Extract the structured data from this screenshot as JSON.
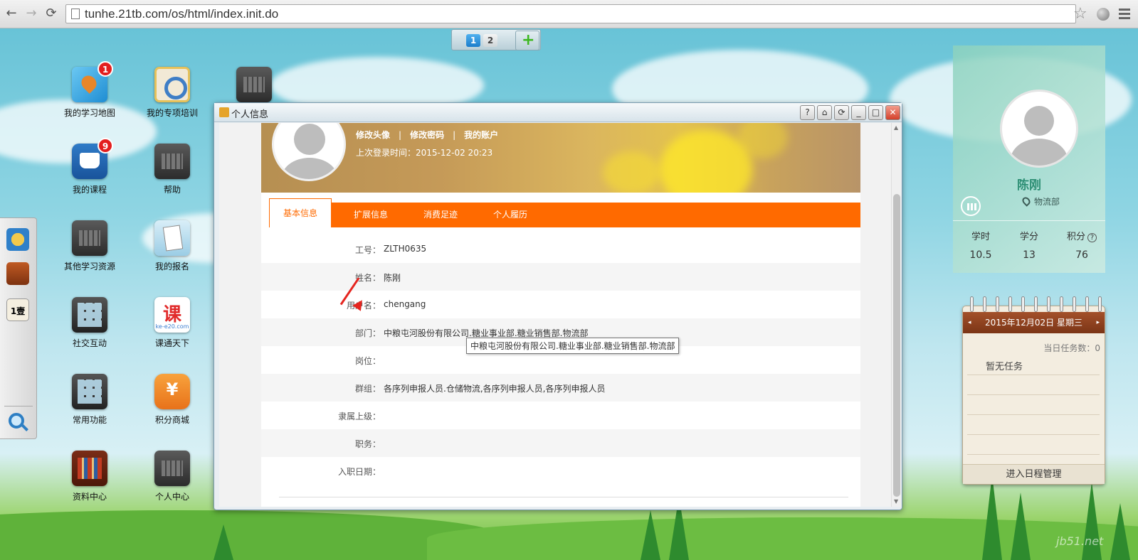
{
  "browser": {
    "url": "tunhe.21tb.com/os/html/index.init.do"
  },
  "switcher": {
    "desktops": [
      "1",
      "2"
    ],
    "add_label": "+"
  },
  "desktop_icons": [
    {
      "label": "我的学习地图",
      "badge": "1",
      "icon": "map-icon"
    },
    {
      "label": "我的专项培训",
      "icon": "training-icon"
    },
    {
      "label": "",
      "icon": "app-icon"
    },
    {
      "label": "我的课程",
      "badge": "9",
      "icon": "course-icon"
    },
    {
      "label": "帮助",
      "icon": "help-icon"
    },
    {
      "label": "其他学习资源",
      "icon": "resources-icon"
    },
    {
      "label": "我的报名",
      "icon": "signup-icon"
    },
    {
      "label": "社交互动",
      "icon": "social-icon"
    },
    {
      "label": "课通天下",
      "icon": "ke-icon",
      "glyph": "课",
      "sub": "ke-e20.com"
    },
    {
      "label": "常用功能",
      "icon": "functions-icon"
    },
    {
      "label": "积分商城",
      "icon": "shop-icon",
      "glyph": "¥"
    },
    {
      "label": "资料中心",
      "icon": "books-icon"
    },
    {
      "label": "个人中心",
      "icon": "personal-icon"
    }
  ],
  "dock": {
    "calendar_glyph": "1壹"
  },
  "window": {
    "title": "个人信息",
    "buttons": [
      "?",
      "⌂",
      "⟳",
      "_",
      "□",
      "✕"
    ],
    "banner": {
      "links": [
        "修改头像",
        "修改密码",
        "我的账户"
      ],
      "separator": "|",
      "last_login": "上次登录时间：2015-12-02 20:23"
    },
    "tabs": [
      "基本信息",
      "扩展信息",
      "消费足迹",
      "个人履历"
    ],
    "fields": [
      {
        "label": "工号：",
        "value": "ZLTH0635"
      },
      {
        "label": "姓名：",
        "value": "陈刚"
      },
      {
        "label": "用户名：",
        "value": "chengang"
      },
      {
        "label": "部门：",
        "value": "中粮屯河股份有限公司.糖业事业部.糖业销售部.物流部"
      },
      {
        "label": "岗位：",
        "value": ""
      },
      {
        "label": "群组：",
        "value": "各序列申报人员.仓储物流,各序列申报人员,各序列申报人员"
      },
      {
        "label": "隶属上级：",
        "value": ""
      },
      {
        "label": "职务：",
        "value": ""
      },
      {
        "label": "入职日期：",
        "value": ""
      }
    ],
    "tooltip": "中粮屯河股份有限公司.糖业事业部.糖业销售部.物流部"
  },
  "user_panel": {
    "name": "陈刚",
    "dept": "物流部",
    "stats": [
      {
        "label": "学时",
        "value": "10.5"
      },
      {
        "label": "学分",
        "value": "13"
      },
      {
        "label": "积分",
        "value": "76"
      }
    ],
    "help_glyph": "?"
  },
  "calendar": {
    "date": "2015年12月02日  星期三",
    "prev": "◂",
    "next": "▸",
    "task_count": "当日任务数：0",
    "no_task": "暂无任务",
    "footer": "进入日程管理"
  },
  "watermark": "jb51.net",
  "colors": {
    "accent": "#ff6a00",
    "user_name": "#2e8f75"
  }
}
